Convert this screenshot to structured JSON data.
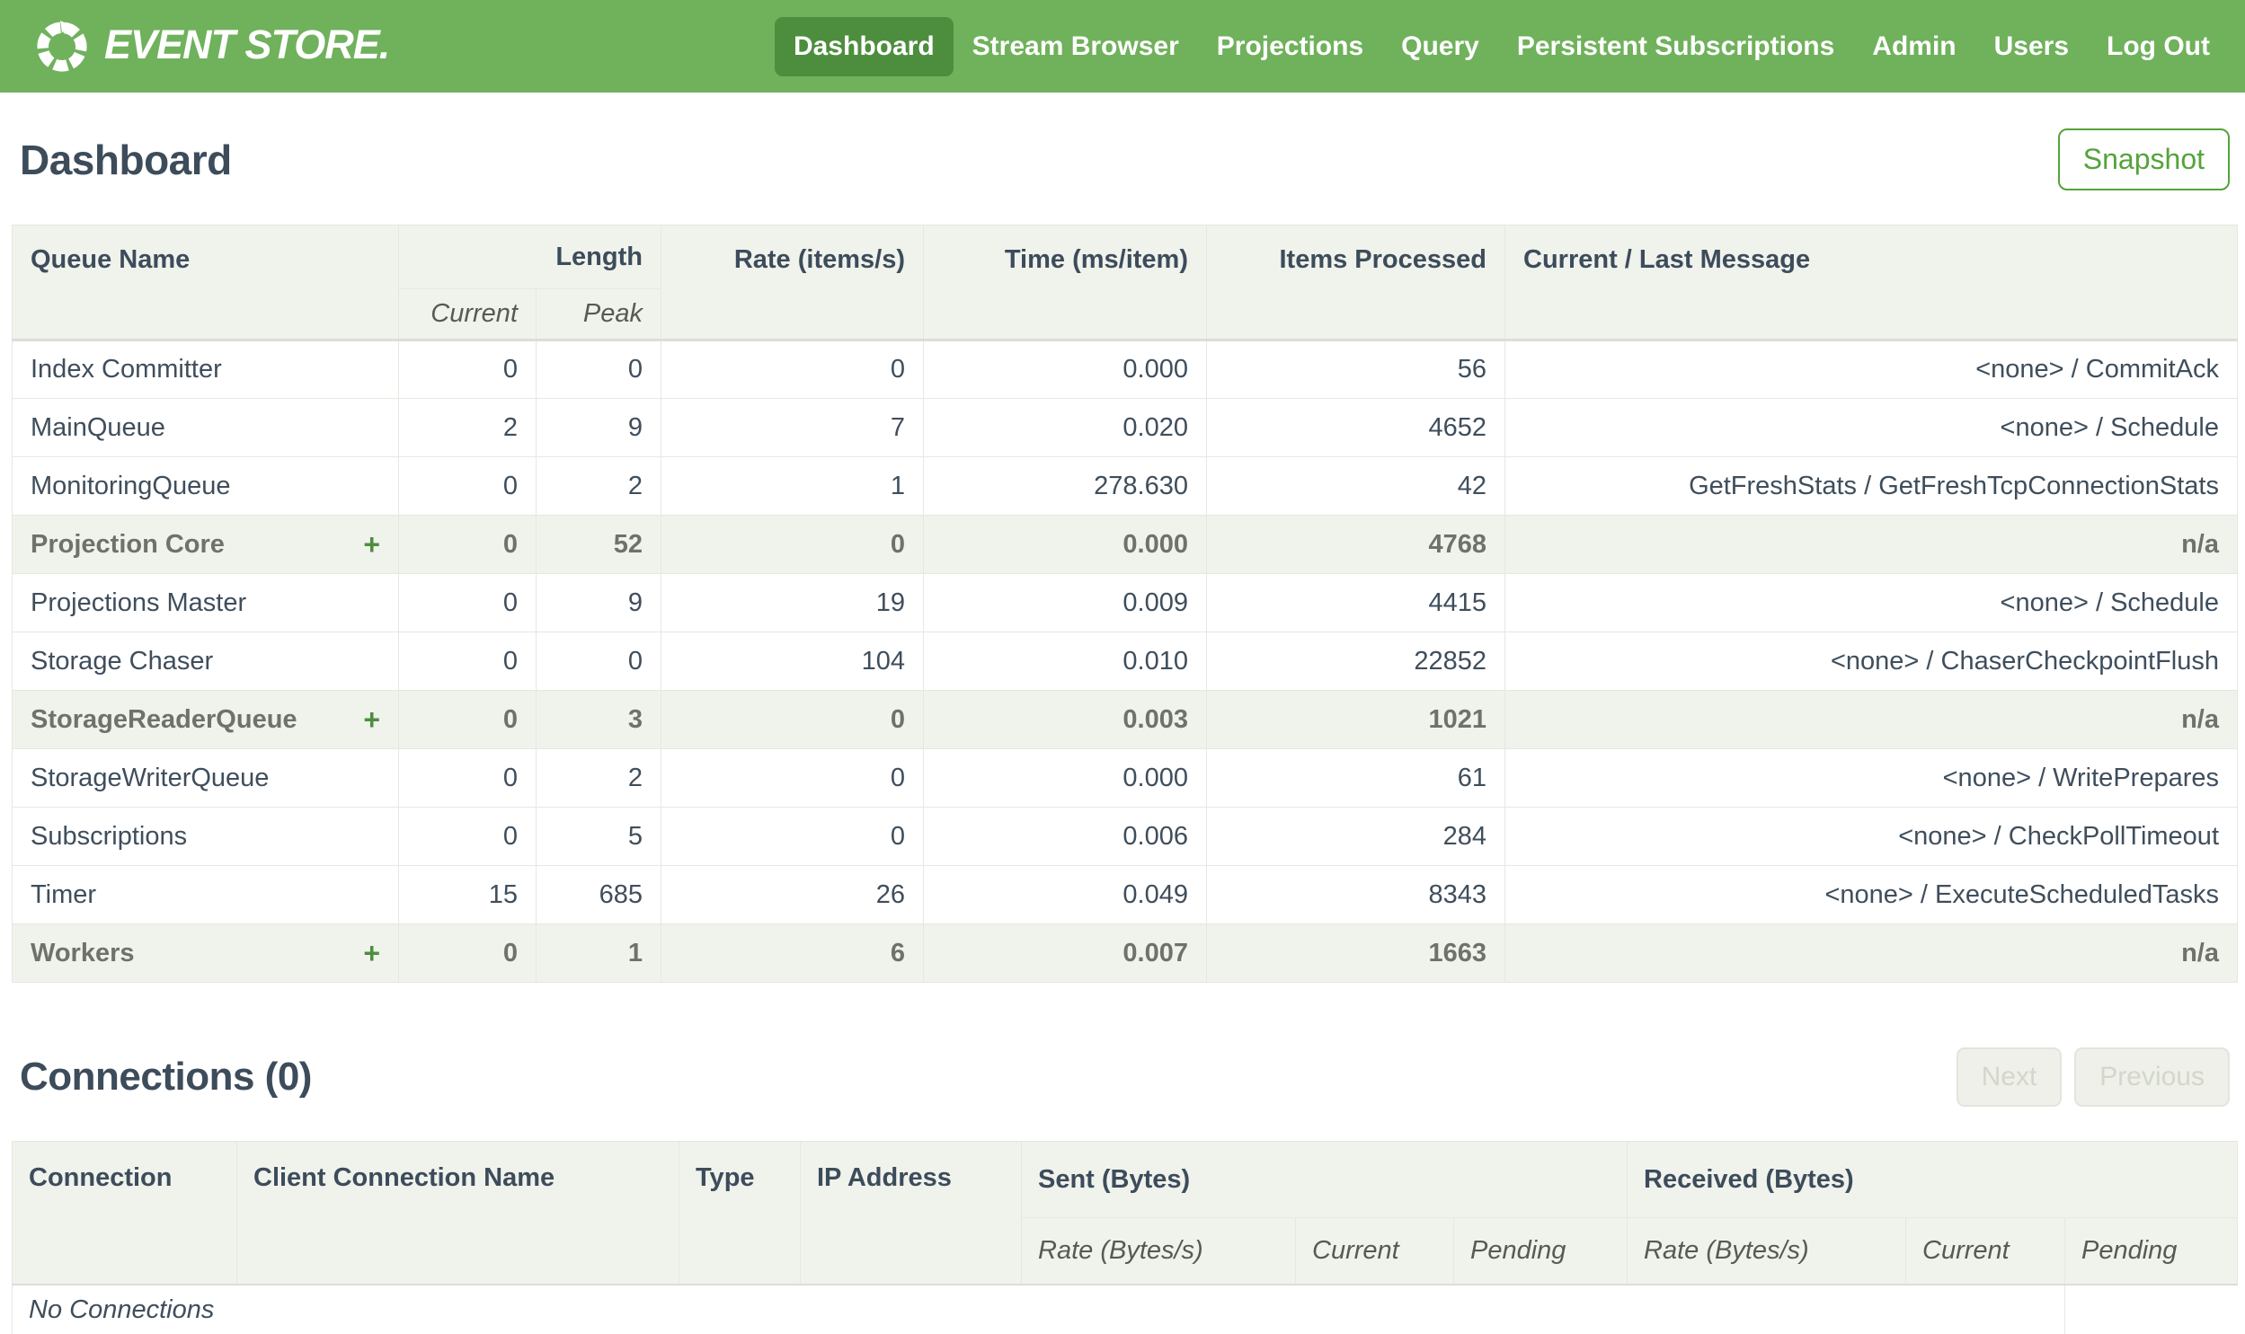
{
  "brand": {
    "name": "EVENT STORE."
  },
  "colors": {
    "navbar_green": "#70b15c",
    "active_green": "#4d8e3e",
    "button_green": "#55a33b",
    "header_bg": "#f0f2ec",
    "text_dark": "#3d4c5b"
  },
  "nav": {
    "items": [
      {
        "label": "Dashboard",
        "active": true
      },
      {
        "label": "Stream Browser",
        "active": false
      },
      {
        "label": "Projections",
        "active": false
      },
      {
        "label": "Query",
        "active": false
      },
      {
        "label": "Persistent Subscriptions",
        "active": false
      },
      {
        "label": "Admin",
        "active": false
      },
      {
        "label": "Users",
        "active": false
      },
      {
        "label": "Log Out",
        "active": false
      }
    ]
  },
  "page": {
    "title": "Dashboard"
  },
  "toolbar": {
    "snapshot_label": "Snapshot"
  },
  "queues": {
    "headers": {
      "queue_name": "Queue Name",
      "length": "Length",
      "current": "Current",
      "peak": "Peak",
      "rate": "Rate (items/s)",
      "time": "Time (ms/item)",
      "items_processed": "Items Processed",
      "message": "Current / Last Message"
    },
    "expand_symbol": "+",
    "rows": [
      {
        "name": "Index Committer",
        "group": false,
        "current": "0",
        "peak": "0",
        "rate": "0",
        "time": "0.000",
        "items": "56",
        "message": "<none> / CommitAck"
      },
      {
        "name": "MainQueue",
        "group": false,
        "current": "2",
        "peak": "9",
        "rate": "7",
        "time": "0.020",
        "items": "4652",
        "message": "<none> / Schedule"
      },
      {
        "name": "MonitoringQueue",
        "group": false,
        "current": "0",
        "peak": "2",
        "rate": "1",
        "time": "278.630",
        "items": "42",
        "message": "GetFreshStats / GetFreshTcpConnectionStats"
      },
      {
        "name": "Projection Core",
        "group": true,
        "current": "0",
        "peak": "52",
        "rate": "0",
        "time": "0.000",
        "items": "4768",
        "message": "n/a"
      },
      {
        "name": "Projections Master",
        "group": false,
        "current": "0",
        "peak": "9",
        "rate": "19",
        "time": "0.009",
        "items": "4415",
        "message": "<none> / Schedule"
      },
      {
        "name": "Storage Chaser",
        "group": false,
        "current": "0",
        "peak": "0",
        "rate": "104",
        "time": "0.010",
        "items": "22852",
        "message": "<none> / ChaserCheckpointFlush"
      },
      {
        "name": "StorageReaderQueue",
        "group": true,
        "current": "0",
        "peak": "3",
        "rate": "0",
        "time": "0.003",
        "items": "1021",
        "message": "n/a"
      },
      {
        "name": "StorageWriterQueue",
        "group": false,
        "current": "0",
        "peak": "2",
        "rate": "0",
        "time": "0.000",
        "items": "61",
        "message": "<none> / WritePrepares"
      },
      {
        "name": "Subscriptions",
        "group": false,
        "current": "0",
        "peak": "5",
        "rate": "0",
        "time": "0.006",
        "items": "284",
        "message": "<none> / CheckPollTimeout"
      },
      {
        "name": "Timer",
        "group": false,
        "current": "15",
        "peak": "685",
        "rate": "26",
        "time": "0.049",
        "items": "8343",
        "message": "<none> / ExecuteScheduledTasks"
      },
      {
        "name": "Workers",
        "group": true,
        "current": "0",
        "peak": "1",
        "rate": "6",
        "time": "0.007",
        "items": "1663",
        "message": "n/a"
      }
    ]
  },
  "connections": {
    "title": "Connections (0)",
    "pagination": {
      "next": "Next",
      "previous": "Previous"
    },
    "headers": {
      "connection": "Connection",
      "client_name": "Client Connection Name",
      "type": "Type",
      "ip": "IP Address",
      "sent": "Sent (Bytes)",
      "received": "Received (Bytes)",
      "rate": "Rate (Bytes/s)",
      "current": "Current",
      "pending": "Pending"
    },
    "empty_message": "No Connections"
  }
}
